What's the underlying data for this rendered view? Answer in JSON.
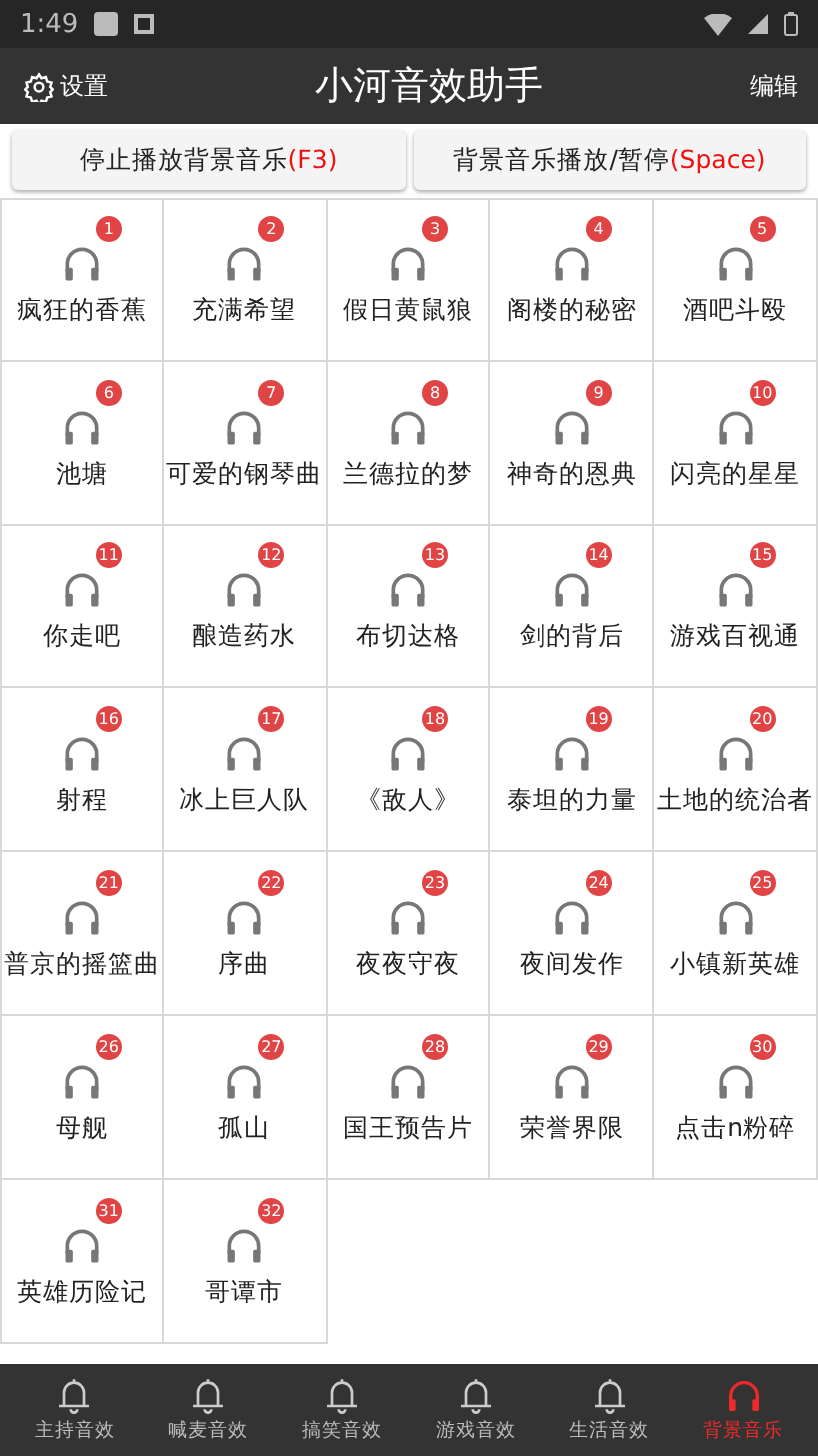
{
  "status_bar": {
    "time": "1:49"
  },
  "app_bar": {
    "settings": "设置",
    "title": "小河音效助手",
    "edit": "编辑"
  },
  "actions": [
    {
      "label": "停止播放背景音乐",
      "key": "(F3)"
    },
    {
      "label": "背景音乐播放/暂停",
      "key": "(Space)"
    }
  ],
  "sounds": [
    {
      "badge": "1",
      "name": "疯狂的香蕉"
    },
    {
      "badge": "2",
      "name": "充满希望"
    },
    {
      "badge": "3",
      "name": "假日黄鼠狼"
    },
    {
      "badge": "4",
      "name": "阁楼的秘密"
    },
    {
      "badge": "5",
      "name": "酒吧斗殴"
    },
    {
      "badge": "6",
      "name": "池塘"
    },
    {
      "badge": "7",
      "name": "可爱的钢琴曲"
    },
    {
      "badge": "8",
      "name": "兰德拉的梦"
    },
    {
      "badge": "9",
      "name": "神奇的恩典"
    },
    {
      "badge": "10",
      "name": "闪亮的星星"
    },
    {
      "badge": "11",
      "name": "你走吧"
    },
    {
      "badge": "12",
      "name": "酿造药水"
    },
    {
      "badge": "13",
      "name": "布切达格"
    },
    {
      "badge": "14",
      "name": "剑的背后"
    },
    {
      "badge": "15",
      "name": "游戏百视通"
    },
    {
      "badge": "16",
      "name": "射程"
    },
    {
      "badge": "17",
      "name": "冰上巨人队"
    },
    {
      "badge": "18",
      "name": "《敌人》"
    },
    {
      "badge": "19",
      "name": "泰坦的力量"
    },
    {
      "badge": "20",
      "name": "土地的统治者"
    },
    {
      "badge": "21",
      "name": "普京的摇篮曲"
    },
    {
      "badge": "22",
      "name": "序曲"
    },
    {
      "badge": "23",
      "name": "夜夜守夜"
    },
    {
      "badge": "24",
      "name": "夜间发作"
    },
    {
      "badge": "25",
      "name": "小镇新英雄"
    },
    {
      "badge": "26",
      "name": "母舰"
    },
    {
      "badge": "27",
      "name": "孤山"
    },
    {
      "badge": "28",
      "name": "国王预告片"
    },
    {
      "badge": "29",
      "name": "荣誉界限"
    },
    {
      "badge": "30",
      "name": "点击n粉碎"
    },
    {
      "badge": "31",
      "name": "英雄历险记"
    },
    {
      "badge": "32",
      "name": "哥谭市"
    }
  ],
  "bottom_nav": [
    {
      "label": "主持音效",
      "kind": "bell",
      "selected": false
    },
    {
      "label": "喊麦音效",
      "kind": "bell",
      "selected": false
    },
    {
      "label": "搞笑音效",
      "kind": "bell",
      "selected": false
    },
    {
      "label": "游戏音效",
      "kind": "bell",
      "selected": false
    },
    {
      "label": "生活音效",
      "kind": "bell",
      "selected": false
    },
    {
      "label": "背景音乐",
      "kind": "headphones",
      "selected": true
    }
  ]
}
